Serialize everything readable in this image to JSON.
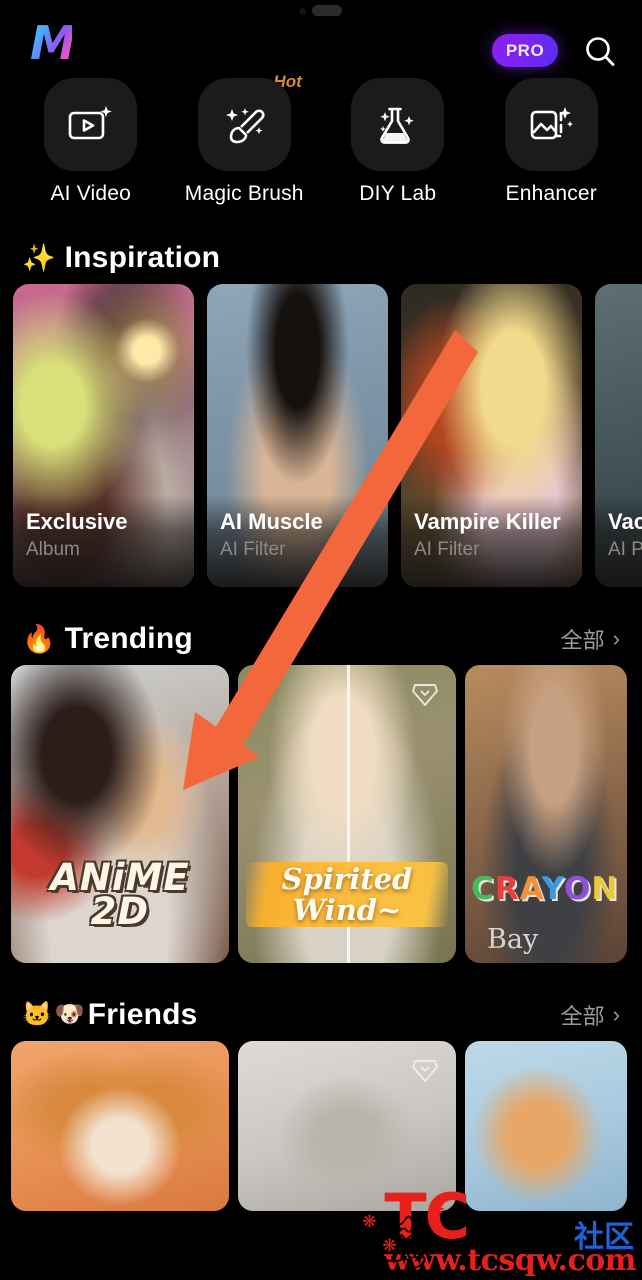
{
  "app": {
    "logo_letter": "M",
    "pro_badge": "PRO",
    "search_icon": "search-icon"
  },
  "nav": {
    "items": [
      {
        "label": "AI Video",
        "icon": "video-frame-sparkle-icon",
        "badge": ""
      },
      {
        "label": "Magic Brush",
        "icon": "magic-brush-icon",
        "badge": "Hot"
      },
      {
        "label": "DIY Lab",
        "icon": "flask-sparkle-icon",
        "badge": ""
      },
      {
        "label": "Enhancer",
        "icon": "image-sparkle-icon",
        "badge": ""
      }
    ]
  },
  "sections": {
    "inspiration": {
      "emoji": "✨",
      "title": "Inspiration",
      "cards": [
        {
          "name": "Exclusive",
          "subtitle": "Album",
          "art": "art-exclusive"
        },
        {
          "name": "AI Muscle",
          "subtitle": "AI Filter",
          "art": "art-muscle"
        },
        {
          "name": "Vampire Killer",
          "subtitle": "AI Filter",
          "art": "art-vampire"
        },
        {
          "name": "Vac",
          "subtitle": "AI P",
          "art": "art-vacation"
        }
      ]
    },
    "trending": {
      "emoji": "🔥",
      "title": "Trending",
      "more_label": "全部",
      "more_chevron": "›",
      "cards": [
        {
          "title": "ANiME 2D",
          "art": "art-anime2d",
          "vip": false
        },
        {
          "title": "Spirited Wind~",
          "art": "art-spirited",
          "vip": true
        },
        {
          "title": "CRAYON B",
          "subtitle": "Bay",
          "art": "art-crayon",
          "vip": false
        }
      ]
    },
    "friends": {
      "emoji_cat": "🐱",
      "emoji_dog": "🐶",
      "title": "Friends",
      "more_label": "全部",
      "more_chevron": "›",
      "cards": [
        {
          "art": "art-corgi",
          "vip": false
        },
        {
          "art": "art-cat",
          "vip": true
        },
        {
          "art": "art-kitten",
          "vip": false
        }
      ]
    }
  },
  "annotation": {
    "arrow_color": "#f2683c",
    "arrow_name": "orange-pointer-arrow"
  },
  "watermark": {
    "brand": "TC",
    "brand_cn": "社区",
    "url": "www.tcsqw.com"
  },
  "colors": {
    "background": "#000000",
    "tile": "#1b1b1d",
    "accent_pro": "#7a24f5",
    "hot": "#d98a25",
    "muted_text": "#9b9b9b"
  }
}
